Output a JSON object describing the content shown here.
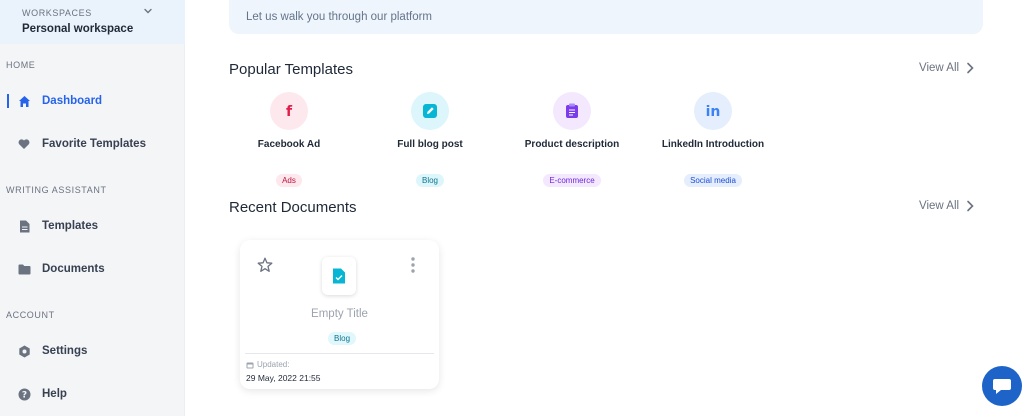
{
  "sidebar": {
    "workspace_label": "WORKSPACES",
    "workspace_name": "Personal workspace",
    "sections": {
      "home": "HOME",
      "writing": "WRITING ASSISTANT",
      "account": "ACCOUNT"
    },
    "items": {
      "dashboard": "Dashboard",
      "favorites": "Favorite Templates",
      "templates": "Templates",
      "documents": "Documents",
      "settings": "Settings",
      "help": "Help"
    }
  },
  "banner": {
    "text": "Let us walk you through our platform"
  },
  "popular": {
    "title": "Popular Templates",
    "view_all": "View All",
    "items": [
      {
        "name": "Facebook Ad",
        "badge": "Ads",
        "icon": "facebook-icon"
      },
      {
        "name": "Full blog post",
        "badge": "Blog",
        "icon": "edit-icon"
      },
      {
        "name": "Product description",
        "badge": "E-commerce",
        "icon": "clipboard-icon"
      },
      {
        "name": "LinkedIn Introduction",
        "badge": "Social media",
        "icon": "linkedin-icon"
      }
    ]
  },
  "recent": {
    "title": "Recent Documents",
    "view_all": "View All",
    "docs": [
      {
        "title": "Empty Title",
        "badge": "Blog",
        "updated_label": "Updated:",
        "updated_date": "29 May, 2022 21:55"
      }
    ]
  },
  "colors": {
    "accent": "#2563eb",
    "facebook": "#e11d48",
    "blog": "#06b6d4",
    "ecommerce": "#7c3aed",
    "linkedin": "#3b82f6",
    "chat": "#1e64c8"
  }
}
